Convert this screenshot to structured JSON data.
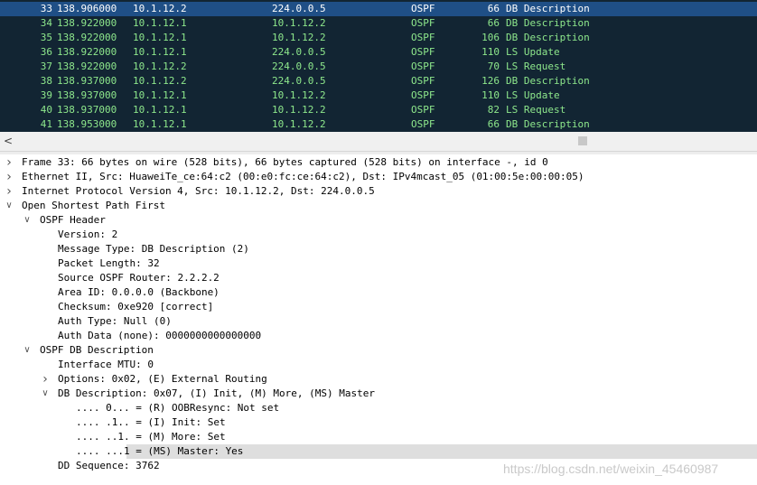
{
  "packets": [
    {
      "no": "33",
      "time": "138.906000",
      "src": "10.1.12.2",
      "dst": "224.0.0.5",
      "proto": "OSPF",
      "len": "66",
      "info": "DB Description",
      "selected": true
    },
    {
      "no": "34",
      "time": "138.922000",
      "src": "10.1.12.1",
      "dst": "10.1.12.2",
      "proto": "OSPF",
      "len": "66",
      "info": "DB Description"
    },
    {
      "no": "35",
      "time": "138.922000",
      "src": "10.1.12.1",
      "dst": "10.1.12.2",
      "proto": "OSPF",
      "len": "106",
      "info": "DB Description"
    },
    {
      "no": "36",
      "time": "138.922000",
      "src": "10.1.12.1",
      "dst": "224.0.0.5",
      "proto": "OSPF",
      "len": "110",
      "info": "LS Update"
    },
    {
      "no": "37",
      "time": "138.922000",
      "src": "10.1.12.2",
      "dst": "224.0.0.5",
      "proto": "OSPF",
      "len": "70",
      "info": "LS Request"
    },
    {
      "no": "38",
      "time": "138.937000",
      "src": "10.1.12.2",
      "dst": "224.0.0.5",
      "proto": "OSPF",
      "len": "126",
      "info": "DB Description"
    },
    {
      "no": "39",
      "time": "138.937000",
      "src": "10.1.12.1",
      "dst": "10.1.12.2",
      "proto": "OSPF",
      "len": "110",
      "info": "LS Update"
    },
    {
      "no": "40",
      "time": "138.937000",
      "src": "10.1.12.1",
      "dst": "10.1.12.2",
      "proto": "OSPF",
      "len": "82",
      "info": "LS Request"
    },
    {
      "no": "41",
      "time": "138.953000",
      "src": "10.1.12.1",
      "dst": "10.1.12.2",
      "proto": "OSPF",
      "len": "66",
      "info": "DB Description"
    }
  ],
  "details": [
    {
      "text": "Frame 33: 66 bytes on wire (528 bits), 66 bytes captured (528 bits) on interface -, id 0",
      "level": 0,
      "toggle": "collapsed"
    },
    {
      "text": "Ethernet II, Src: HuaweiTe_ce:64:c2 (00:e0:fc:ce:64:c2), Dst: IPv4mcast_05 (01:00:5e:00:00:05)",
      "level": 0,
      "toggle": "collapsed"
    },
    {
      "text": "Internet Protocol Version 4, Src: 10.1.12.2, Dst: 224.0.0.5",
      "level": 0,
      "toggle": "collapsed"
    },
    {
      "text": "Open Shortest Path First",
      "level": 0,
      "toggle": "expanded"
    },
    {
      "text": "OSPF Header",
      "level": 1,
      "toggle": "expanded"
    },
    {
      "text": "Version: 2",
      "level": 2,
      "toggle": "none"
    },
    {
      "text": "Message Type: DB Description (2)",
      "level": 2,
      "toggle": "none"
    },
    {
      "text": "Packet Length: 32",
      "level": 2,
      "toggle": "none"
    },
    {
      "text": "Source OSPF Router: 2.2.2.2",
      "level": 2,
      "toggle": "none"
    },
    {
      "text": "Area ID: 0.0.0.0 (Backbone)",
      "level": 2,
      "toggle": "none"
    },
    {
      "text": "Checksum: 0xe920 [correct]",
      "level": 2,
      "toggle": "none"
    },
    {
      "text": "Auth Type: Null (0)",
      "level": 2,
      "toggle": "none"
    },
    {
      "text": "Auth Data (none): 0000000000000000",
      "level": 2,
      "toggle": "none"
    },
    {
      "text": "OSPF DB Description",
      "level": 1,
      "toggle": "expanded"
    },
    {
      "text": "Interface MTU: 0",
      "level": 2,
      "toggle": "none"
    },
    {
      "text": "Options: 0x02, (E) External Routing",
      "level": 2,
      "toggle": "collapsed"
    },
    {
      "text": "DB Description: 0x07, (I) Init, (M) More, (MS) Master",
      "level": 2,
      "toggle": "expanded"
    },
    {
      "text": ".... 0... = (R) OOBResync: Not set",
      "level": 3,
      "toggle": "none"
    },
    {
      "text": ".... .1.. = (I) Init: Set",
      "level": 3,
      "toggle": "none"
    },
    {
      "text": ".... ..1. = (M) More: Set",
      "level": 3,
      "toggle": "none"
    },
    {
      "text": ".... ...1 = (MS) Master: Yes",
      "level": 3,
      "toggle": "none",
      "highlighted": true
    },
    {
      "text": "DD Sequence: 3762",
      "level": 2,
      "toggle": "none"
    }
  ],
  "scrollbar": {
    "left_arrow": "<"
  },
  "watermark": "https://blog.csdn.net/weixin_45460987",
  "colors": {
    "list_bg": "#122533",
    "list_text": "#8ee88c",
    "selected_bg": "#1f4f86",
    "detail_highlight": "#dedede"
  },
  "icons": {
    "collapsed": "chevron-right-icon",
    "expanded": "chevron-down-icon"
  }
}
